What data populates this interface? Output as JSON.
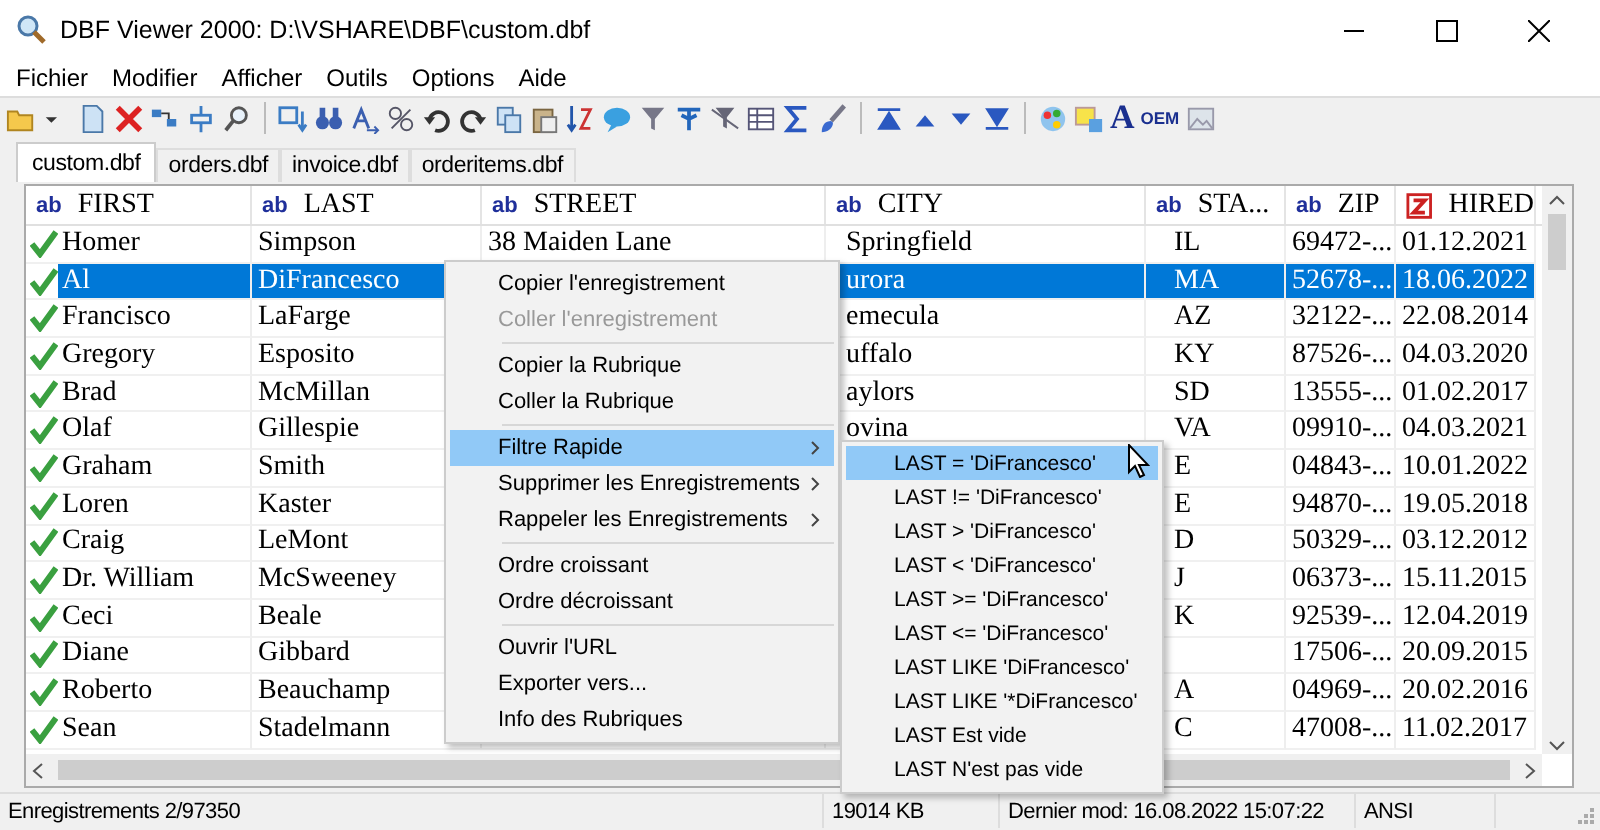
{
  "window": {
    "title": "DBF Viewer 2000: D:\\VSHARE\\DBF\\custom.dbf"
  },
  "menu_bar": [
    "Fichier",
    "Modifier",
    "Afficher",
    "Outils",
    "Options",
    "Aide"
  ],
  "toolbar": {
    "text_buttons": [
      "A",
      "OEM"
    ]
  },
  "tabs": [
    {
      "label": "custom.dbf",
      "selected": true
    },
    {
      "label": "orders.dbf",
      "selected": false
    },
    {
      "label": "invoice.dbf",
      "selected": false
    },
    {
      "label": "orderitems.dbf",
      "selected": false
    }
  ],
  "grid": {
    "columns": [
      {
        "kind": "text",
        "badge": "ab",
        "label": "FIRST"
      },
      {
        "kind": "text",
        "badge": "ab",
        "label": "LAST"
      },
      {
        "kind": "text",
        "badge": "ab",
        "label": "STREET"
      },
      {
        "kind": "text",
        "badge": "ab",
        "label": "CITY"
      },
      {
        "kind": "text",
        "badge": "ab",
        "label": "STA..."
      },
      {
        "kind": "text",
        "badge": "ab",
        "label": "ZIP"
      },
      {
        "kind": "date",
        "label": "HIRED"
      }
    ],
    "rows": [
      {
        "marked": true,
        "selected": false,
        "cells": [
          "Homer",
          "Simpson",
          "38 Maiden Lane",
          "Springfield",
          "IL",
          "69472-...",
          "01.12.2021"
        ]
      },
      {
        "marked": true,
        "selected": true,
        "cells": [
          "Al",
          "DiFrancesco",
          null,
          "urora",
          "MA",
          "52678-...",
          "18.06.2022"
        ]
      },
      {
        "marked": true,
        "selected": false,
        "cells": [
          "Francisco",
          "LaFarge",
          null,
          "emecula",
          "AZ",
          "32122-...",
          "22.08.2014"
        ]
      },
      {
        "marked": true,
        "selected": false,
        "cells": [
          "Gregory",
          "Esposito",
          null,
          "uffalo",
          "KY",
          "87526-...",
          "04.03.2020"
        ]
      },
      {
        "marked": true,
        "selected": false,
        "cells": [
          "Brad",
          "McMillan",
          null,
          "aylors",
          "SD",
          "13555-...",
          "01.02.2017"
        ]
      },
      {
        "marked": true,
        "selected": false,
        "cells": [
          "Olaf",
          "Gillespie",
          null,
          "ovina",
          "VA",
          "09910-...",
          "04.03.2021"
        ]
      },
      {
        "marked": true,
        "selected": false,
        "cells": [
          "Graham",
          "Smith",
          null,
          null,
          "E",
          "04843-...",
          "10.01.2022"
        ]
      },
      {
        "marked": true,
        "selected": false,
        "cells": [
          "Loren",
          "Kaster",
          null,
          null,
          "E",
          "94870-...",
          "19.05.2018"
        ]
      },
      {
        "marked": true,
        "selected": false,
        "cells": [
          "Craig",
          "LeMont",
          null,
          null,
          "D",
          "50329-...",
          "03.12.2012"
        ]
      },
      {
        "marked": true,
        "selected": false,
        "cells": [
          "Dr. William",
          "McSweeney",
          null,
          null,
          "J",
          "06373-...",
          "15.11.2015"
        ]
      },
      {
        "marked": true,
        "selected": false,
        "cells": [
          "Ceci",
          "Beale",
          null,
          null,
          "K",
          "92539-...",
          "12.04.2019"
        ]
      },
      {
        "marked": true,
        "selected": false,
        "cells": [
          "Diane",
          "Gibbard",
          null,
          null,
          null,
          "17506-...",
          "20.09.2015"
        ]
      },
      {
        "marked": true,
        "selected": false,
        "cells": [
          "Roberto",
          "Beauchamp",
          null,
          null,
          "A",
          "04969-...",
          "20.02.2016"
        ]
      },
      {
        "marked": true,
        "selected": false,
        "cells": [
          "Sean",
          "Stadelmann",
          null,
          null,
          "C",
          "47008-...",
          "11.02.2017"
        ]
      }
    ]
  },
  "context_menu": {
    "items": [
      {
        "kind": "item",
        "label": "Copier l'enregistrement",
        "disabled": false,
        "selected": false,
        "submenu": false
      },
      {
        "kind": "item",
        "label": "Coller l'enregistrement",
        "disabled": true,
        "selected": false,
        "submenu": false
      },
      {
        "kind": "separator"
      },
      {
        "kind": "item",
        "label": "Copier la Rubrique",
        "disabled": false,
        "selected": false,
        "submenu": false
      },
      {
        "kind": "item",
        "label": "Coller la Rubrique",
        "disabled": false,
        "selected": false,
        "submenu": false
      },
      {
        "kind": "separator"
      },
      {
        "kind": "item",
        "label": "Filtre Rapide",
        "disabled": false,
        "selected": true,
        "submenu": true
      },
      {
        "kind": "item",
        "label": "Supprimer les Enregistrements",
        "disabled": false,
        "selected": false,
        "submenu": true
      },
      {
        "kind": "item",
        "label": "Rappeler les Enregistrements",
        "disabled": false,
        "selected": false,
        "submenu": true
      },
      {
        "kind": "separator"
      },
      {
        "kind": "item",
        "label": "Ordre croissant",
        "disabled": false,
        "selected": false,
        "submenu": false
      },
      {
        "kind": "item",
        "label": "Ordre décroissant",
        "disabled": false,
        "selected": false,
        "submenu": false
      },
      {
        "kind": "separator"
      },
      {
        "kind": "item",
        "label": "Ouvrir l'URL",
        "disabled": false,
        "selected": false,
        "submenu": false
      },
      {
        "kind": "item",
        "label": "Exporter vers...",
        "disabled": false,
        "selected": false,
        "submenu": false
      },
      {
        "kind": "item",
        "label": "Info des Rubriques",
        "disabled": false,
        "selected": false,
        "submenu": false
      }
    ]
  },
  "submenu": {
    "items": [
      {
        "kind": "item",
        "label": "LAST = 'DiFrancesco'",
        "disabled": false,
        "selected": true,
        "submenu": false
      },
      {
        "kind": "item",
        "label": "LAST != 'DiFrancesco'",
        "disabled": false,
        "selected": false,
        "submenu": false
      },
      {
        "kind": "item",
        "label": "LAST > 'DiFrancesco'",
        "disabled": false,
        "selected": false,
        "submenu": false
      },
      {
        "kind": "item",
        "label": "LAST < 'DiFrancesco'",
        "disabled": false,
        "selected": false,
        "submenu": false
      },
      {
        "kind": "item",
        "label": "LAST >= 'DiFrancesco'",
        "disabled": false,
        "selected": false,
        "submenu": false
      },
      {
        "kind": "item",
        "label": "LAST <= 'DiFrancesco'",
        "disabled": false,
        "selected": false,
        "submenu": false
      },
      {
        "kind": "item",
        "label": "LAST LIKE 'DiFrancesco'",
        "disabled": false,
        "selected": false,
        "submenu": false
      },
      {
        "kind": "item",
        "label": "LAST LIKE '*DiFrancesco'",
        "disabled": false,
        "selected": false,
        "submenu": false
      },
      {
        "kind": "item",
        "label": "LAST Est vide",
        "disabled": false,
        "selected": false,
        "submenu": false
      },
      {
        "kind": "item",
        "label": "LAST N'est pas vide",
        "disabled": false,
        "selected": false,
        "submenu": false
      }
    ]
  },
  "status_bar": [
    "Enregistrements 2/97350",
    "19014 KB",
    "Dernier mod: 16.08.2022 15:07:22",
    "ANSI"
  ]
}
